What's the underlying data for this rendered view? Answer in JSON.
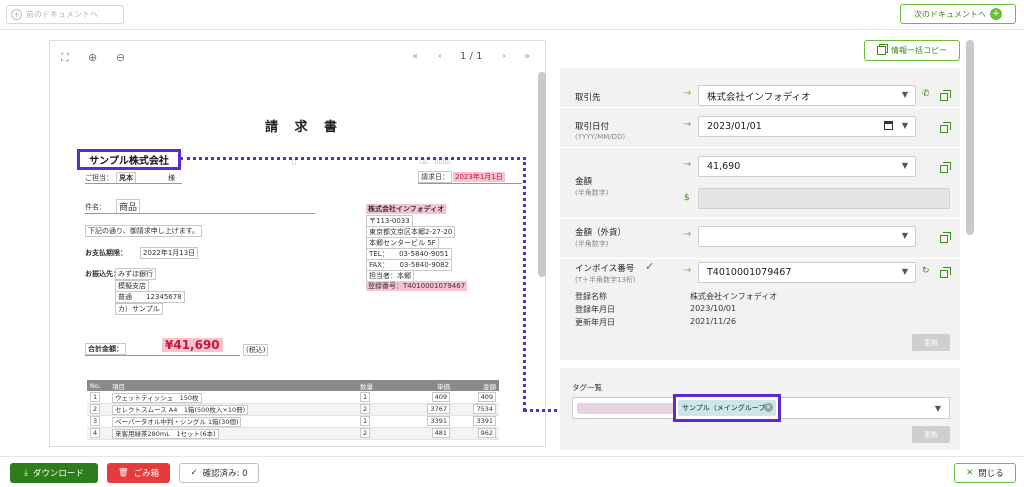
{
  "topbar": {
    "prev_label": "前のドキュメントへ",
    "next_label": "次のドキュメントへ"
  },
  "viewer": {
    "page_indicator": "1 / 1"
  },
  "document": {
    "title": "請 求 書",
    "customer_name": "サンプル株式会社",
    "contact_label": "ご担当：",
    "contact_name": "見本",
    "honorific": "様",
    "invoice_date_label": "請求日：",
    "invoice_date": "2023年1月1日",
    "subject_label": "件名：",
    "subject": "商品",
    "intro": "下記の通り、御請求申し上げます。",
    "due_label": "お支払期限：",
    "due_date": "2022年1月13日",
    "bank_label": "お振込先：",
    "bank_lines": [
      "みずほ銀行",
      "模擬支店",
      "普通　　12345678",
      "カ）サンプル"
    ],
    "issuer_name": "株式会社インフォディオ",
    "issuer_lines": [
      "〒113-0033",
      "東京都文京区本郷2-27-20",
      "本郷センタービル 5F",
      "TEL：　　03-5840-9051",
      "FAX：　　03-5840-9082",
      "担当者：本郷"
    ],
    "issuer_reg": "登録番号：T4010001079467",
    "total_label": "合計金額：",
    "total_amount": "¥41,690",
    "tax_note": "(税込)",
    "table": {
      "headers": [
        "No.",
        "項目",
        "数量",
        "単価",
        "金額"
      ],
      "rows": [
        {
          "no": "1",
          "item": "ウェットティッシュ　150枚",
          "qty": "1",
          "price": "409",
          "amount": "409"
        },
        {
          "no": "2",
          "item": "セレクトスムース A4　1箱(500枚入×10冊)",
          "qty": "2",
          "price": "3767",
          "amount": "7534"
        },
        {
          "no": "3",
          "item": "ペーパータオル中判・シングル 1箱(30個)",
          "qty": "1",
          "price": "3391",
          "amount": "3391"
        },
        {
          "no": "4",
          "item": "来客用緑茶280mL　1セット(6本)",
          "qty": "2",
          "price": "481",
          "amount": "962"
        }
      ]
    }
  },
  "panel": {
    "copy_all_label": "情報一括コピー",
    "fields": {
      "partner_label": "取引先",
      "partner_value": "株式会社インフォディオ",
      "date_label": "取引日付",
      "date_sub": "(YYYY/MM/DD)",
      "date_value": "2023/01/01",
      "amount_label": "金額",
      "amount_sub": "(半角数字)",
      "amount_value": "41,690",
      "foreign_label": "金額（外貨）",
      "foreign_sub": "(半角数字)",
      "invoice_label": "インボイス番号",
      "invoice_sub": "(T＋半角数字13桁)",
      "invoice_value": "T4010001079467"
    },
    "registration": {
      "name_label": "登録名称",
      "name_value": "株式会社インフォディオ",
      "reg_date_label": "登録年月日",
      "reg_date_value": "2023/10/01",
      "upd_date_label": "更新年月日",
      "upd_date_value": "2021/11/26"
    },
    "update_label": "更新"
  },
  "tags": {
    "label": "タグ一覧",
    "chip_label": "サンプル（メイングループ）",
    "update_label": "更新"
  },
  "bottombar": {
    "download_label": "ダウンロード",
    "trash_label": "ごみ箱",
    "confirmed_label": "確認済み: 0",
    "close_label": "閉じる"
  },
  "colors": {
    "accent_green": "#6abf3a",
    "dark_green": "#2e7d1b",
    "danger_red": "#e53b3b",
    "highlight_purple": "#5b2bd0",
    "highlight_pink": "#f6c4ce"
  }
}
